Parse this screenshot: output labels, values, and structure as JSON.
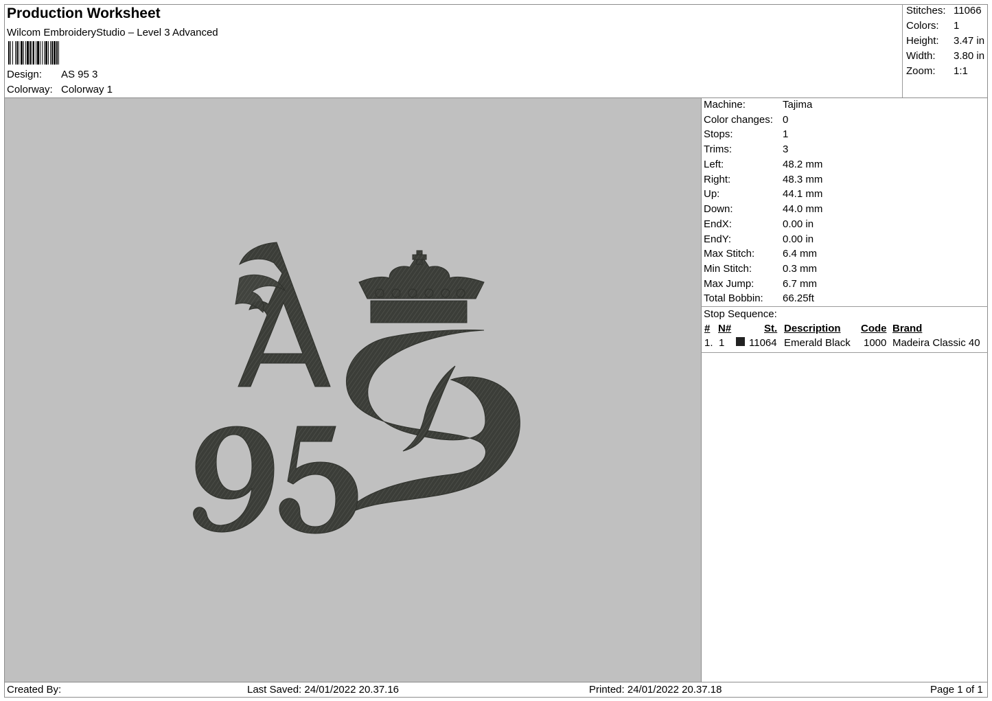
{
  "header": {
    "title": "Production Worksheet",
    "subtitle": "Wilcom EmbroideryStudio – Level 3 Advanced",
    "design_label": "Design:",
    "design_value": "AS 95 3",
    "colorway_label": "Colorway:",
    "colorway_value": "Colorway 1"
  },
  "summary": [
    {
      "label": "Stitches:",
      "value": "11066"
    },
    {
      "label": "Colors:",
      "value": "1"
    },
    {
      "label": "Height:",
      "value": "3.47 in"
    },
    {
      "label": "Width:",
      "value": "3.80 in"
    },
    {
      "label": "Zoom:",
      "value": "1:1"
    }
  ],
  "machine_info": [
    {
      "label": "Machine:",
      "value": "Tajima"
    },
    {
      "label": "Color changes:",
      "value": "0"
    },
    {
      "label": "Stops:",
      "value": "1"
    },
    {
      "label": "Trims:",
      "value": "3"
    },
    {
      "label": "Left:",
      "value": "48.2 mm"
    },
    {
      "label": "Right:",
      "value": "48.3 mm"
    },
    {
      "label": "Up:",
      "value": "44.1 mm"
    },
    {
      "label": "Down:",
      "value": "44.0 mm"
    },
    {
      "label": "EndX:",
      "value": "0.00 in"
    },
    {
      "label": "EndY:",
      "value": "0.00 in"
    },
    {
      "label": "Max Stitch:",
      "value": "6.4 mm"
    },
    {
      "label": "Min Stitch:",
      "value": "0.3 mm"
    },
    {
      "label": "Max Jump:",
      "value": "6.7 mm"
    },
    {
      "label": "Total Bobbin:",
      "value": "66.25ft"
    }
  ],
  "stop_sequence": {
    "title": "Stop Sequence:",
    "columns": [
      "#",
      "N#",
      "St.",
      "Description",
      "Code",
      "Brand"
    ],
    "rows": [
      {
        "num": "1.",
        "n": "1",
        "swatch_color": "#222222",
        "stitches": "11064",
        "description": "Emerald Black",
        "code": "1000",
        "brand": "Madeira Classic 40"
      }
    ]
  },
  "design_preview": {
    "thread_color": "#3b3d38",
    "background_color": "#c0c0c0",
    "icon": "crown-icon"
  },
  "footer": {
    "created_by": "Created By:",
    "last_saved": "Last Saved: 24/01/2022 20.37.16",
    "printed": "Printed: 24/01/2022 20.37.18",
    "page": "Page 1 of 1"
  }
}
